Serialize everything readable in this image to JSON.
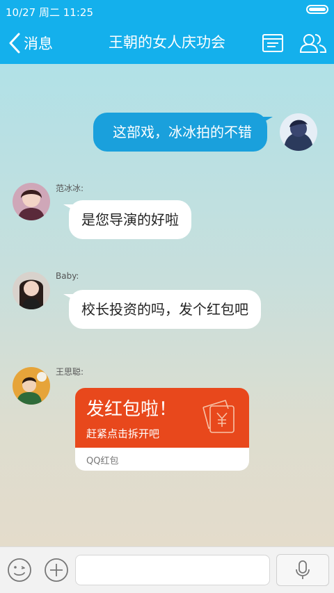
{
  "status_bar": {
    "time": "10/27 周二 11:25"
  },
  "header": {
    "back_label": "消息",
    "title": "王朝的女人庆功会"
  },
  "messages": [
    {
      "direction": "out",
      "text": "这部戏，冰冰拍的不错"
    },
    {
      "direction": "in",
      "sender": "范冰冰:",
      "text": "是您导演的好啦"
    },
    {
      "direction": "in",
      "sender": "Baby:",
      "text": "校长投资的吗，发个红包吧"
    },
    {
      "direction": "in",
      "sender": "王思聪:",
      "type": "red_packet",
      "title": "发红包啦！",
      "subtitle": "赶紧点击拆开吧",
      "footer": "QQ红包"
    }
  ],
  "colors": {
    "accent": "#14b0ec",
    "bubble_out": "#1aa0dc",
    "red_packet": "#e8481c"
  }
}
